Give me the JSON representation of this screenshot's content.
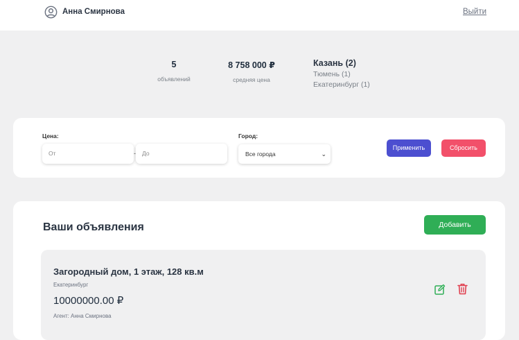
{
  "header": {
    "icon": "user-circle-icon",
    "user_name": "Анна Смирнова",
    "logout_label": "Выйти"
  },
  "stats": {
    "count_value": "5",
    "count_label": "объявлений",
    "avg_price_value": "8 758 000 ₽",
    "avg_price_label": "средняя цена",
    "cities": [
      "Казань (2)",
      "Тюмень (1)",
      "Екатеринбург (1)"
    ]
  },
  "filter": {
    "price_label": "Цена:",
    "price_from_placeholder": "От",
    "price_to_placeholder": "До",
    "city_label": "Город:",
    "city_selected": "Все города",
    "apply_label": "Применить",
    "reset_label": "Сбросить"
  },
  "listings": {
    "title": "Ваши объявления",
    "add_label": "Добавить",
    "items": [
      {
        "title": "Загородный дом, 1 этаж, 128 кв.м",
        "city": "Екатеринбург",
        "price": "10000000.00 ₽",
        "agent": "Агент: Анна Смирнова",
        "edit_icon": "edit-icon",
        "delete_icon": "trash-icon"
      }
    ]
  },
  "colors": {
    "apply": "#4c4fd0",
    "reset": "#f2506a",
    "add": "#2fae56",
    "edit_icon": "#2fae56",
    "delete_icon": "#e04050"
  }
}
